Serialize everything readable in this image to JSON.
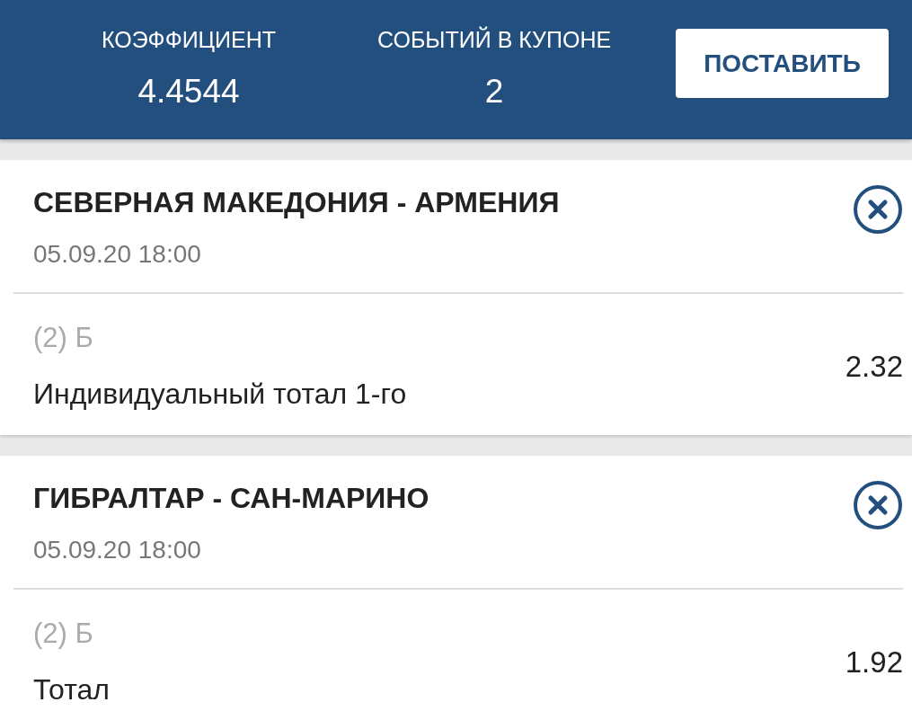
{
  "header": {
    "stats": [
      {
        "label": "КОЭФФИЦИЕНТ",
        "value": "4.4544"
      },
      {
        "label": "СОБЫТИЙ В КУПОНЕ",
        "value": "2"
      }
    ],
    "button": "ПОСТАВИТЬ"
  },
  "bets": [
    {
      "match": "СЕВЕРНАЯ МАКЕДОНИЯ - АРМЕНИЯ",
      "datetime": "05.09.20 18:00",
      "outcome": "(2) Б",
      "market": "Индивидуальный тотал 1-го",
      "odds": "2.32"
    },
    {
      "match": "ГИБРАЛТАР - САН-МАРИНО",
      "datetime": "05.09.20 18:00",
      "outcome": "(2) Б",
      "market": "Тотал",
      "odds": "1.92"
    }
  ]
}
